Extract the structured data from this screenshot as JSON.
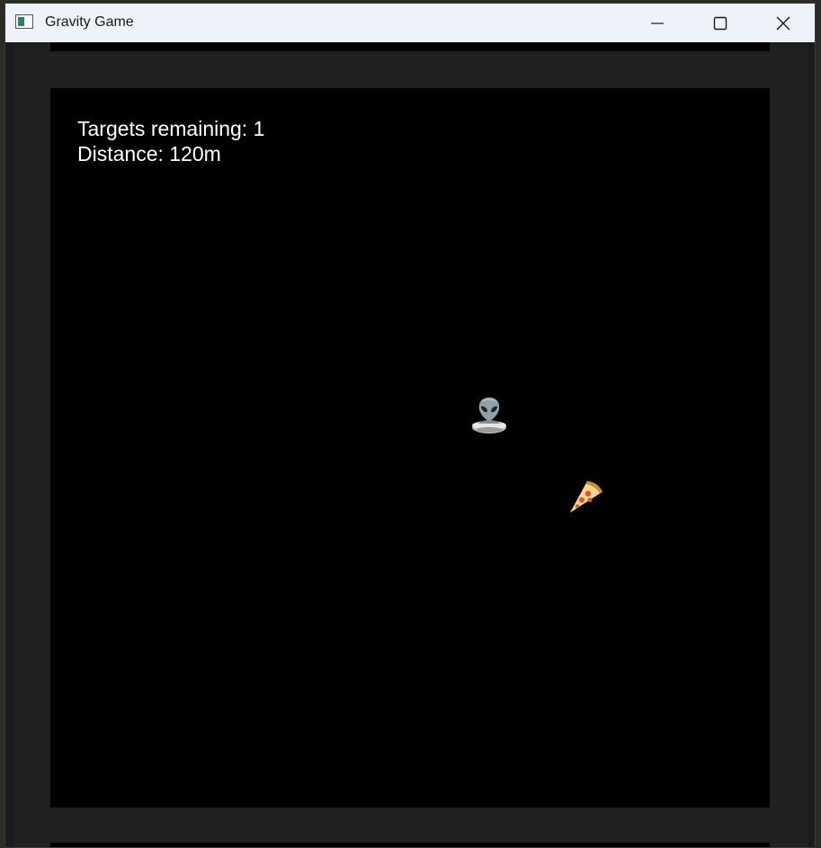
{
  "window": {
    "title": "Gravity Game",
    "icon": "app-window-icon"
  },
  "controls": {
    "minimize_icon": "minimize-icon",
    "maximize_icon": "maximize-icon",
    "close_icon": "close-icon"
  },
  "hud": {
    "targets_text": "Targets remaining: 1",
    "distance_text": "Distance: 120m"
  },
  "game": {
    "background_color": "#000000",
    "player_sprite": "alien-ufo-icon",
    "target_sprite": "pizza-icon"
  }
}
